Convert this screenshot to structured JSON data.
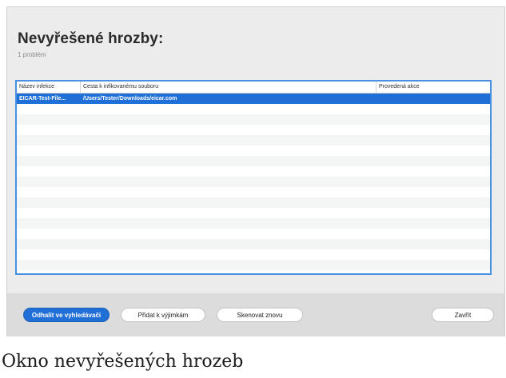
{
  "window": {
    "title": "Nevyřešené hrozby:",
    "subtitle": "1 problém"
  },
  "table": {
    "columns": [
      "Název infekce",
      "Cesta k infikovanému souboru",
      "Provedená akce"
    ],
    "rows": [
      {
        "name": "EICAR-Test-File...",
        "path": "/Users/Tester/Downloads/eicar.com",
        "action": ""
      }
    ]
  },
  "footer": {
    "reveal_label": "Odhalit ve vyhledávači",
    "exclude_label": "Přidat k výjimkám",
    "rescan_label": "Skenovat znovu",
    "close_label": "Zavřít"
  },
  "colors": {
    "accent": "#1f6fd6",
    "table_border": "#4a90e2"
  },
  "caption": "Okno nevyřešených hrozeb"
}
